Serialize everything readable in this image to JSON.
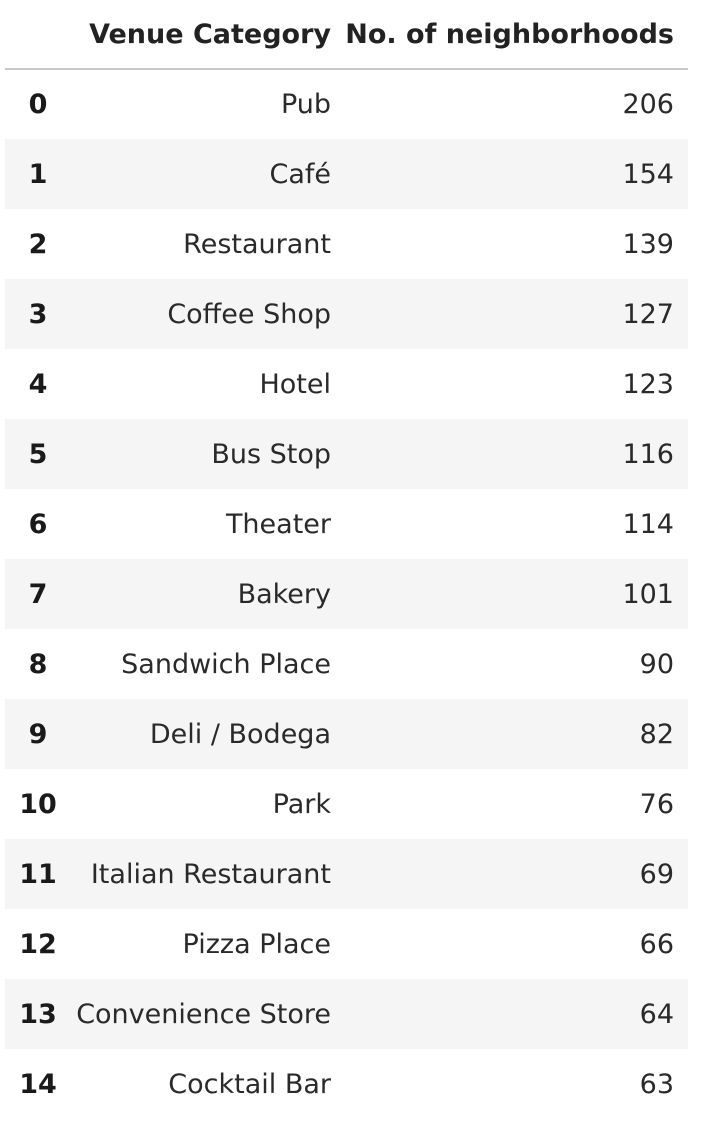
{
  "table": {
    "columns": [
      "Venue Category",
      "No. of neighborhoods"
    ],
    "rows": [
      {
        "index": "0",
        "category": "Pub",
        "count": "206"
      },
      {
        "index": "1",
        "category": "Café",
        "count": "154"
      },
      {
        "index": "2",
        "category": "Restaurant",
        "count": "139"
      },
      {
        "index": "3",
        "category": "Coffee Shop",
        "count": "127"
      },
      {
        "index": "4",
        "category": "Hotel",
        "count": "123"
      },
      {
        "index": "5",
        "category": "Bus Stop",
        "count": "116"
      },
      {
        "index": "6",
        "category": "Theater",
        "count": "114"
      },
      {
        "index": "7",
        "category": "Bakery",
        "count": "101"
      },
      {
        "index": "8",
        "category": "Sandwich Place",
        "count": "90"
      },
      {
        "index": "9",
        "category": "Deli / Bodega",
        "count": "82"
      },
      {
        "index": "10",
        "category": "Park",
        "count": "76"
      },
      {
        "index": "11",
        "category": "Italian Restaurant",
        "count": "69"
      },
      {
        "index": "12",
        "category": "Pizza Place",
        "count": "66"
      },
      {
        "index": "13",
        "category": "Convenience Store",
        "count": "64"
      },
      {
        "index": "14",
        "category": "Cocktail Bar",
        "count": "63"
      }
    ]
  }
}
